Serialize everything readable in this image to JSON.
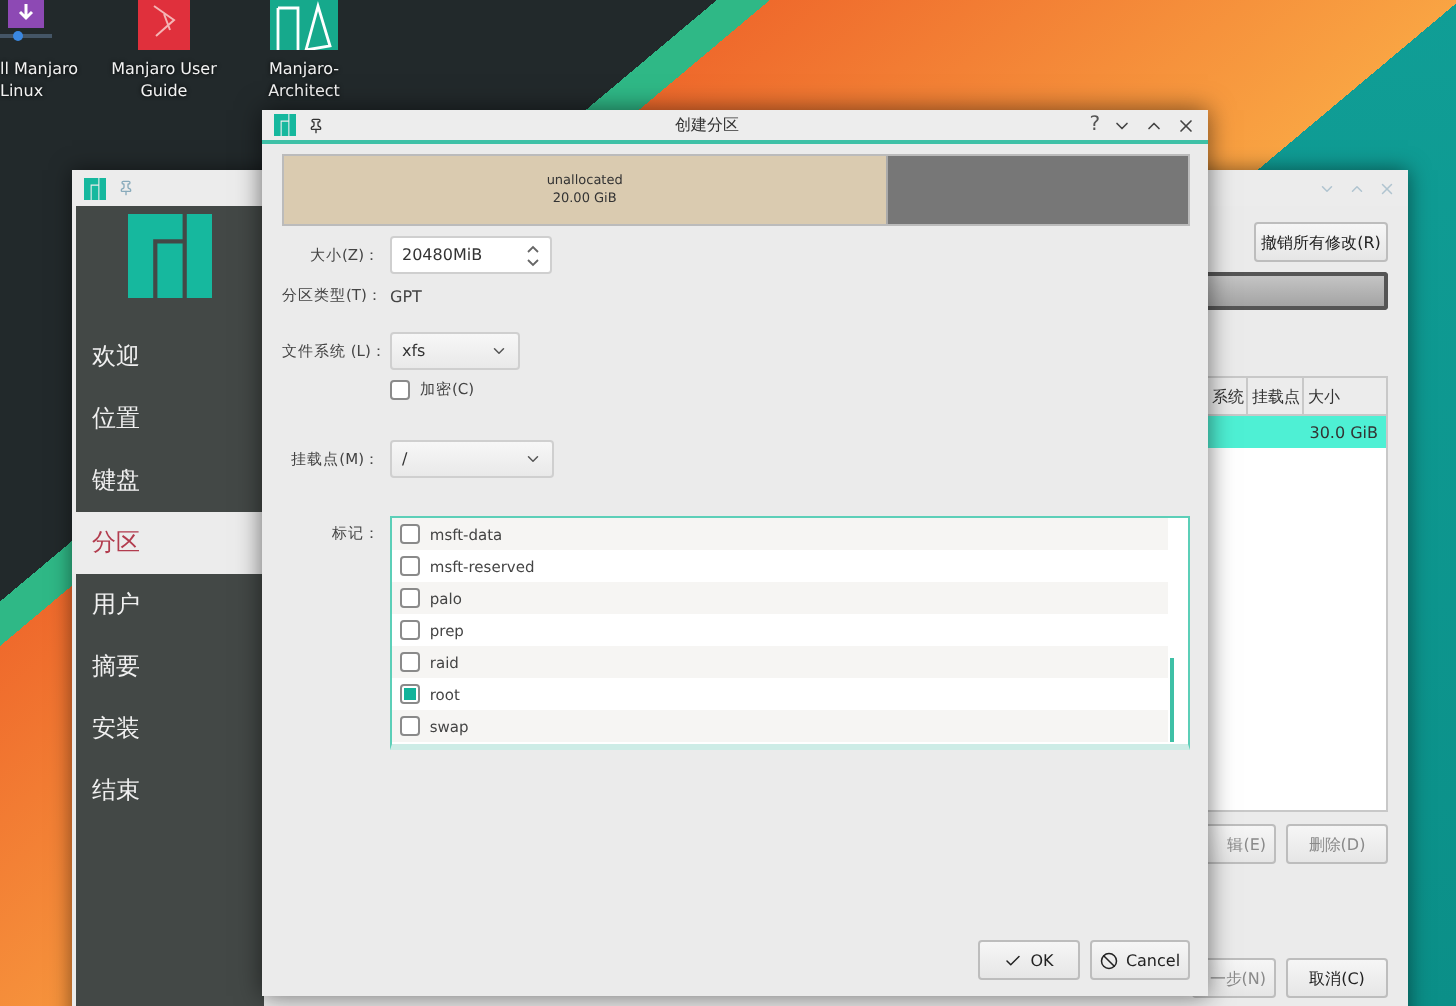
{
  "desktop_icons": [
    {
      "kind": "installer",
      "lines": [
        "ll Manjaro",
        "Linux"
      ]
    },
    {
      "kind": "guide",
      "lines": [
        "Manjaro User",
        "Guide"
      ]
    },
    {
      "kind": "architect",
      "lines": [
        "Manjaro-",
        "Architect"
      ]
    }
  ],
  "installer": {
    "sidebar": [
      {
        "label": "欢迎",
        "selected": false
      },
      {
        "label": "位置",
        "selected": false
      },
      {
        "label": "键盘",
        "selected": false
      },
      {
        "label": "分区",
        "selected": true
      },
      {
        "label": "用户",
        "selected": false
      },
      {
        "label": "摘要",
        "selected": false
      },
      {
        "label": "安装",
        "selected": false
      },
      {
        "label": "结束",
        "selected": false
      }
    ],
    "revert_button": "撤销所有修改(R)",
    "table": {
      "columns": [
        "系统",
        "挂载点",
        "大小"
      ],
      "rows": [
        {
          "cells": [
            "",
            "",
            "30.0 GiB"
          ],
          "selected": true
        }
      ]
    },
    "actions": [
      {
        "label": "辑(E)",
        "disabled": true
      },
      {
        "label": "删除(D)",
        "disabled": true
      }
    ],
    "nav": [
      {
        "label": "一步(N)",
        "disabled": true
      },
      {
        "label": "取消(C)",
        "disabled": false
      }
    ]
  },
  "dialog": {
    "title": "创建分区",
    "help": "?",
    "segments": [
      {
        "kind": "unallocated",
        "label": "unallocated",
        "size": "20.00 GiB"
      },
      {
        "kind": "used"
      }
    ],
    "size": {
      "label": "大小(Z)：",
      "value": "20480MiB"
    },
    "partition_type": {
      "label": "分区类型(T)：",
      "value": "GPT"
    },
    "filesystem": {
      "label": "文件系统 (L)：",
      "value": "xfs"
    },
    "encrypt": {
      "label": "加密(C)",
      "checked": false
    },
    "mount_point": {
      "label": "挂载点(M)：",
      "value": "/"
    },
    "flags": {
      "label": "标记：",
      "items": [
        {
          "label": "msft-data",
          "checked": false
        },
        {
          "label": "msft-reserved",
          "checked": false
        },
        {
          "label": "palo",
          "checked": false
        },
        {
          "label": "prep",
          "checked": false
        },
        {
          "label": "raid",
          "checked": false
        },
        {
          "label": "root",
          "checked": true
        },
        {
          "label": "swap",
          "checked": false
        }
      ]
    },
    "ok_button": "OK",
    "cancel_button": "Cancel"
  }
}
